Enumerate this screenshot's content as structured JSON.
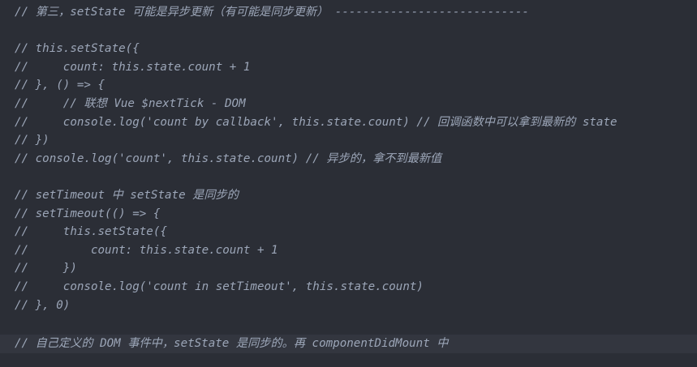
{
  "editor": {
    "lines": [
      "// 第三，setState 可能是异步更新（有可能是同步更新） ----------------------------",
      "",
      "// this.setState({",
      "//     count: this.state.count + 1",
      "// }, () => {",
      "//     // 联想 Vue $nextTick - DOM",
      "//     console.log('count by callback', this.state.count) // 回调函数中可以拿到最新的 state",
      "// })",
      "// console.log('count', this.state.count) // 异步的，拿不到最新值",
      "",
      "// setTimeout 中 setState 是同步的",
      "// setTimeout(() => {",
      "//     this.setState({",
      "//         count: this.state.count + 1",
      "//     })",
      "//     console.log('count in setTimeout', this.state.count)",
      "// }, 0)",
      "",
      "// 自己定义的 DOM 事件中，setState 是同步的。再 componentDidMount 中"
    ],
    "current_line": 19
  },
  "colors": {
    "background": "#2b2e36",
    "current_line_highlight": "#33363f",
    "comment": "#9ca6b8"
  }
}
